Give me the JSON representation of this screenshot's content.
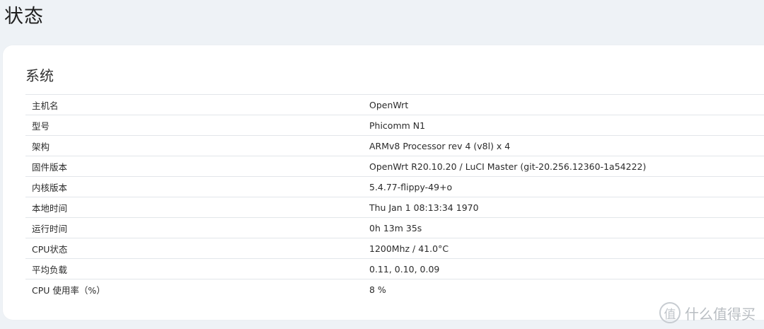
{
  "page": {
    "title": "状态"
  },
  "section": {
    "title": "系统",
    "rows": [
      {
        "key": "主机名",
        "value": "OpenWrt"
      },
      {
        "key": "型号",
        "value": "Phicomm N1"
      },
      {
        "key": "架构",
        "value": "ARMv8 Processor rev 4 (v8l) x 4"
      },
      {
        "key": "固件版本",
        "value": "OpenWrt R20.10.20 / LuCI Master (git-20.256.12360-1a54222)"
      },
      {
        "key": "内核版本",
        "value": "5.4.77-flippy-49+o"
      },
      {
        "key": "本地时间",
        "value": "Thu Jan 1 08:13:34 1970"
      },
      {
        "key": "运行时间",
        "value": "0h 13m 35s"
      },
      {
        "key": "CPU状态",
        "value": "1200Mhz / 41.0°C"
      },
      {
        "key": "平均负载",
        "value": "0.11, 0.10, 0.09"
      },
      {
        "key": "CPU 使用率（%）",
        "value": "8 %"
      }
    ]
  },
  "watermark": {
    "logo_glyph": "值",
    "text": "什么值得买",
    "icon": "smzdm-logo-icon"
  }
}
